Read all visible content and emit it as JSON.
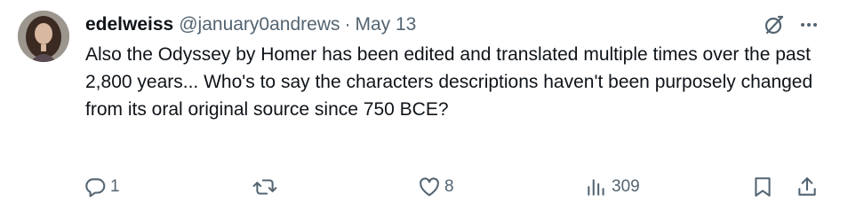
{
  "tweet": {
    "display_name": "edelweiss",
    "handle": "@january0andrews",
    "separator": "·",
    "date": "May 13",
    "text": "Also the Odyssey by Homer has been edited and translated multiple times over the past 2,800 years... Who's to say the characters descriptions haven't been purposely changed from its oral original source since 750 BCE?"
  },
  "actions": {
    "replies": "1",
    "reposts": "",
    "likes": "8",
    "views": "309"
  },
  "icons": {
    "header": [
      "grok-icon",
      "more-icon"
    ],
    "actions": [
      "reply-icon",
      "repost-icon",
      "like-icon",
      "views-icon",
      "bookmark-icon",
      "share-icon"
    ]
  },
  "colors": {
    "text": "#0f1419",
    "secondary": "#536471",
    "background": "#ffffff"
  }
}
